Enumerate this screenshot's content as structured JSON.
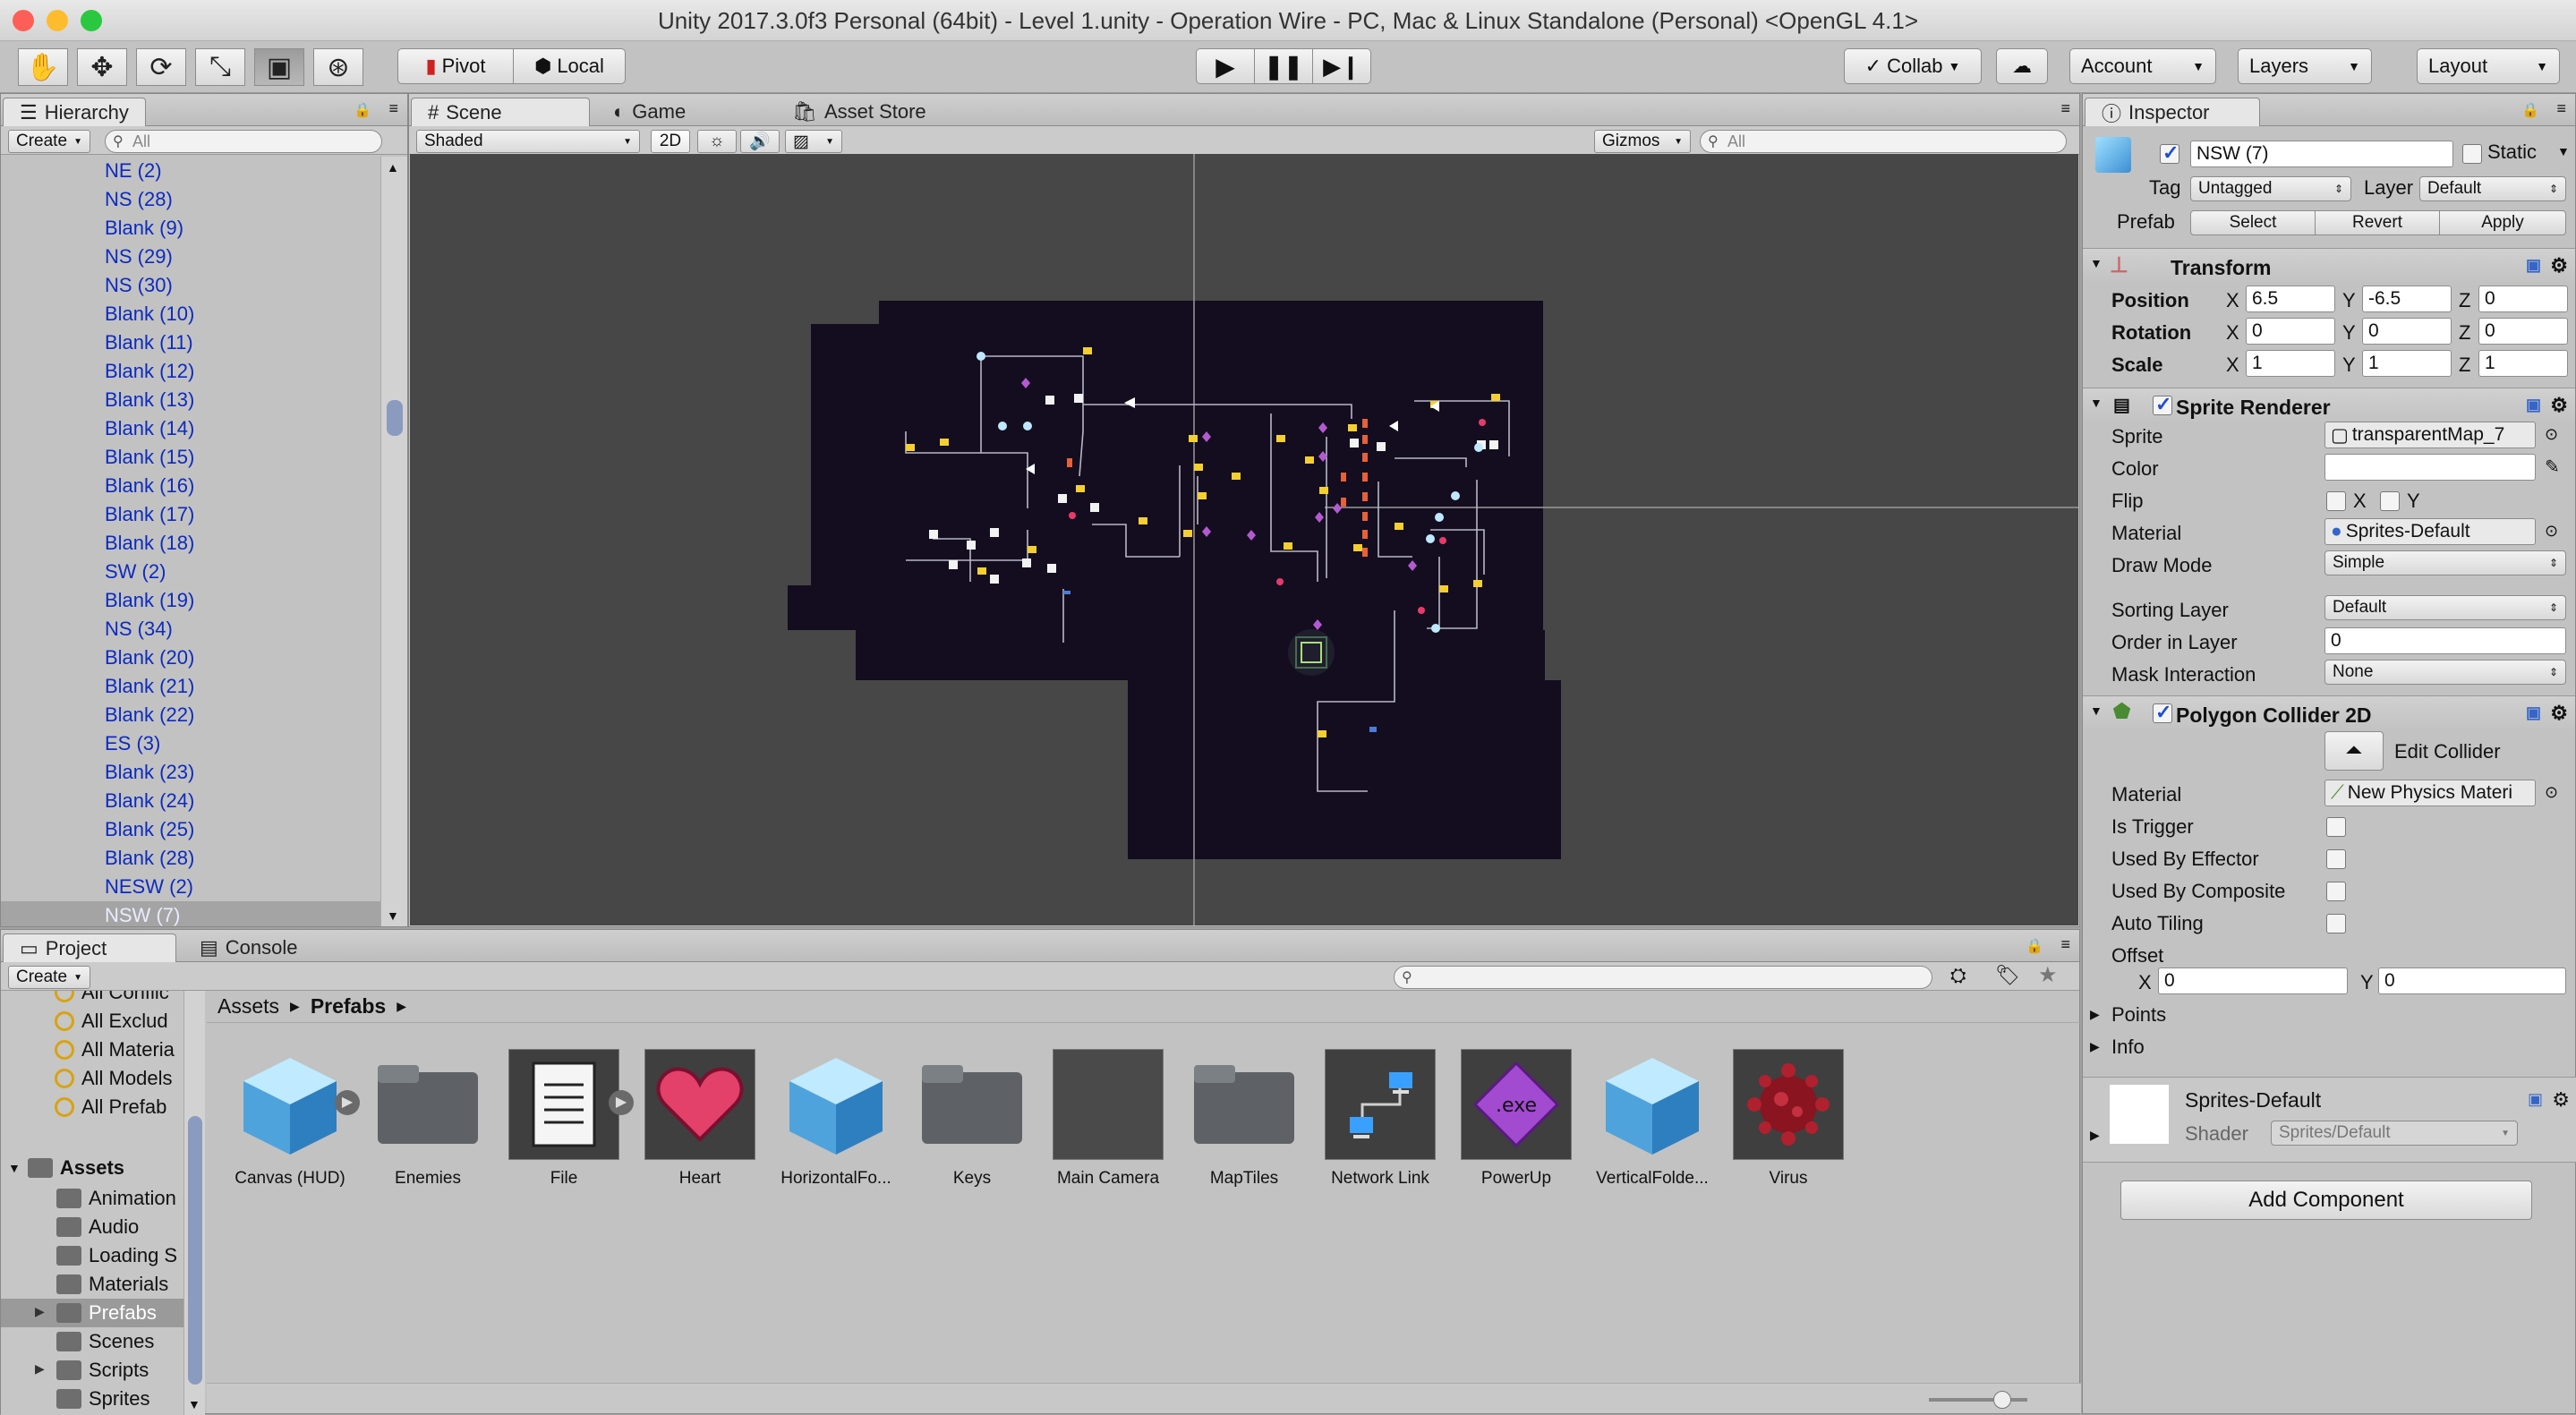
{
  "window": {
    "title": "Unity 2017.3.0f3 Personal (64bit) - Level 1.unity - Operation Wire - PC, Mac & Linux Standalone (Personal) <OpenGL 4.1>"
  },
  "toolbar": {
    "pivot": "Pivot",
    "local": "Local",
    "collab": "Collab",
    "account": "Account",
    "layers": "Layers",
    "layout": "Layout"
  },
  "hierarchy": {
    "tab": "Hierarchy",
    "create": "Create",
    "search_placeholder": "All",
    "items": [
      "NE (2)",
      "NS (28)",
      "Blank (9)",
      "NS (29)",
      "NS (30)",
      "Blank (10)",
      "Blank (11)",
      "Blank (12)",
      "Blank (13)",
      "Blank (14)",
      "Blank (15)",
      "Blank (16)",
      "Blank (17)",
      "Blank (18)",
      "SW (2)",
      "Blank (19)",
      "NS (34)",
      "Blank (20)",
      "Blank (21)",
      "Blank (22)",
      "ES (3)",
      "Blank (23)",
      "Blank (24)",
      "Blank (25)",
      "Blank (28)",
      "NESW (2)",
      "NSW (7)"
    ]
  },
  "scene": {
    "tab_scene": "Scene",
    "tab_game": "Game",
    "tab_store": "Asset Store",
    "shading": "Shaded",
    "mode2d": "2D",
    "gizmos": "Gizmos",
    "search_placeholder": "All"
  },
  "project": {
    "tab_project": "Project",
    "tab_console": "Console",
    "create": "Create",
    "favorites": [
      "All Conflic",
      "All Exclud",
      "All Materia",
      "All Models",
      "All Prefab"
    ],
    "tree_root": "Assets",
    "tree": [
      "Animation",
      "Audio",
      "Loading S",
      "Materials",
      "Prefabs",
      "Scenes",
      "Scripts",
      "Sprites"
    ],
    "breadcrumb": [
      "Assets",
      "Prefabs"
    ],
    "assets": [
      "Canvas (HUD)",
      "Enemies",
      "File",
      "Heart",
      "HorizontalFo...",
      "Keys",
      "Main Camera",
      "MapTiles",
      "Network Link",
      "PowerUp",
      "VerticalFolde...",
      "Virus"
    ],
    "exe_label": ".exe"
  },
  "inspector": {
    "tab": "Inspector",
    "name": "NSW (7)",
    "static": "Static",
    "tag_label": "Tag",
    "tag": "Untagged",
    "layer_label": "Layer",
    "layer": "Default",
    "prefab_label": "Prefab",
    "select": "Select",
    "revert": "Revert",
    "apply": "Apply",
    "transform": {
      "title": "Transform",
      "position": "Position",
      "rotation": "Rotation",
      "scale": "Scale",
      "x": "X",
      "y": "Y",
      "z": "Z",
      "pos": [
        "6.5",
        "-6.5",
        "0"
      ],
      "rot": [
        "0",
        "0",
        "0"
      ],
      "scl": [
        "1",
        "1",
        "1"
      ]
    },
    "sprite_renderer": {
      "title": "Sprite Renderer",
      "sprite_label": "Sprite",
      "sprite": "transparentMap_7",
      "color_label": "Color",
      "flip_label": "Flip",
      "flip_x": "X",
      "flip_y": "Y",
      "material_label": "Material",
      "material": "Sprites-Default",
      "draw_mode_label": "Draw Mode",
      "draw_mode": "Simple",
      "sorting_layer_label": "Sorting Layer",
      "sorting_layer": "Default",
      "order_label": "Order in Layer",
      "order": "0",
      "mask_label": "Mask Interaction",
      "mask": "None"
    },
    "polygon_collider": {
      "title": "Polygon Collider 2D",
      "edit": "Edit Collider",
      "material_label": "Material",
      "material": "New Physics Materi",
      "is_trigger": "Is Trigger",
      "used_by_effector": "Used By Effector",
      "used_by_composite": "Used By Composite",
      "auto_tiling": "Auto Tiling",
      "offset_label": "Offset",
      "x": "X",
      "y": "Y",
      "offset": [
        "0",
        "0"
      ],
      "points": "Points",
      "info": "Info"
    },
    "material_block": {
      "name": "Sprites-Default",
      "shader_label": "Shader",
      "shader": "Sprites/Default"
    },
    "add_component": "Add Component"
  },
  "colors": {
    "map_bg": "#130d1f",
    "scene_bg": "#474747",
    "hier_text": "#0d2bbf",
    "selected_row": "#a4a4a4"
  }
}
